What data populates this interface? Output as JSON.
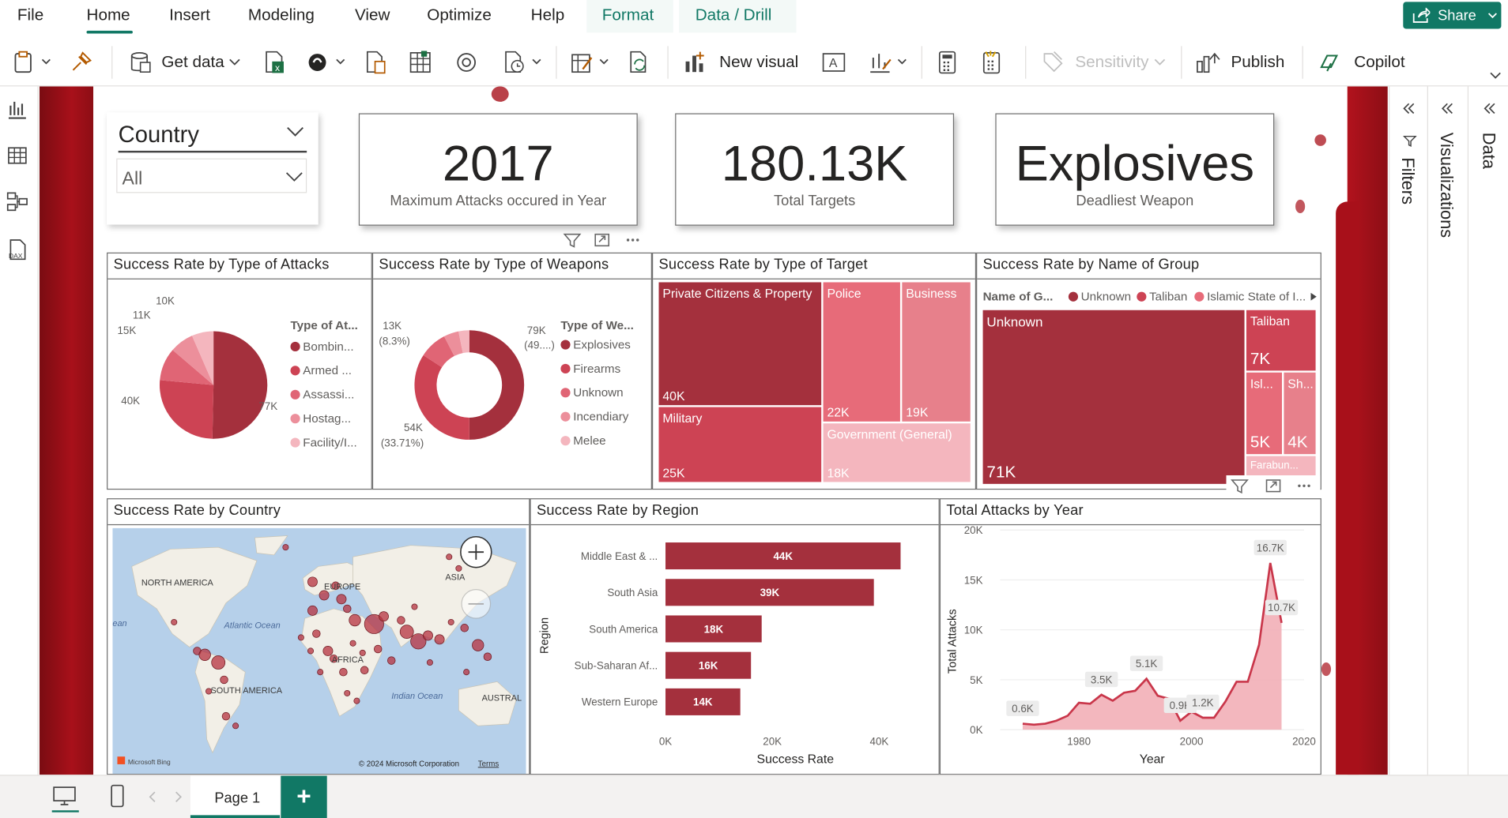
{
  "ribbon": {
    "menus": [
      "File",
      "Home",
      "Insert",
      "Modeling",
      "View",
      "Optimize",
      "Help"
    ],
    "context_menus": [
      "Format",
      "Data / Drill"
    ],
    "share_label": "Share",
    "tools": {
      "get_data": "Get data",
      "new_visual": "New visual",
      "sensitivity": "Sensitivity",
      "publish": "Publish",
      "copilot": "Copilot"
    }
  },
  "panes": {
    "filters": "Filters",
    "visualizations": "Visualizations",
    "data": "Data"
  },
  "slicer": {
    "title": "Country",
    "value": "All"
  },
  "kpis": [
    {
      "value": "2017",
      "label": "Maximum Attacks occured in Year"
    },
    {
      "value": "180.13K",
      "label": "Total Targets"
    },
    {
      "value": "Explosives",
      "label": "Deadliest Weapon"
    }
  ],
  "visuals": {
    "attack_types": {
      "title": "Success Rate by Type of Attacks",
      "legend_title": "Type of At...",
      "legend": [
        "Bombin...",
        "Armed ...",
        "Assassi...",
        "Hostag...",
        "Facility/I..."
      ],
      "labels": [
        "77K",
        "40K",
        "15K",
        "11K",
        "10K"
      ]
    },
    "weapons": {
      "title": "Success Rate by Type of Weapons",
      "legend_title": "Type of We...",
      "legend": [
        "Explosives",
        "Firearms",
        "Unknown",
        "Incendiary",
        "Melee"
      ],
      "labels": {
        "a": "79K",
        "a_pct": "(49....)",
        "b": "54K",
        "b_pct": "(33.71%)",
        "c": "13K",
        "c_pct": "(8.3%)"
      }
    },
    "target": {
      "title": "Success Rate by Type of Target",
      "cells": [
        {
          "name": "Private Citizens & Property",
          "value": "40K"
        },
        {
          "name": "Police",
          "value": "22K"
        },
        {
          "name": "Business",
          "value": "19K"
        },
        {
          "name": "Military",
          "value": "25K"
        },
        {
          "name": "Government (General)",
          "value": "18K"
        }
      ]
    },
    "group": {
      "title": "Success Rate by Name of Group",
      "legend_title": "Name of G...",
      "legend": [
        "Unknown",
        "Taliban",
        "Islamic State of I..."
      ],
      "cells": [
        {
          "name": "Unknown",
          "value": "71K"
        },
        {
          "name": "Taliban",
          "value": "7K"
        },
        {
          "name": "Isl...",
          "value": "5K"
        },
        {
          "name": "Sh...",
          "value": "4K"
        },
        {
          "name": "Farabun...",
          "value": ""
        }
      ]
    },
    "map": {
      "title": "Success Rate by Country",
      "labels": [
        "NORTH AMERICA",
        "EUROPE",
        "ASIA",
        "Atlantic Ocean",
        "AFRICA",
        "SOUTH AMERICA",
        "Indian Ocean",
        "AUSTRAL",
        "ean"
      ],
      "bing": "Microsoft Bing",
      "copyright": "© 2024 Microsoft Corporation",
      "terms": "Terms"
    },
    "region": {
      "title": "Success Rate by Region",
      "xlabel": "Success Rate",
      "ylabel": "Region"
    },
    "year": {
      "title": "Total Attacks by Year",
      "xlabel": "Year",
      "ylabel": "Total Attacks"
    }
  },
  "chart_data": [
    {
      "type": "bar",
      "title": "Success Rate by Region",
      "categories": [
        "Middle East & ...",
        "South Asia",
        "South America",
        "Sub-Saharan Af...",
        "Western Europe"
      ],
      "values": [
        44000,
        39000,
        18000,
        16000,
        14000
      ],
      "data_labels": [
        "44K",
        "39K",
        "18K",
        "16K",
        "14K"
      ],
      "xlabel": "Success Rate",
      "ylabel": "Region",
      "xlim": [
        0,
        45000
      ],
      "xticks": [
        "0K",
        "20K",
        "40K"
      ],
      "color": "#a4303d"
    },
    {
      "type": "area",
      "title": "Total Attacks by Year",
      "x": [
        1970,
        1972,
        1974,
        1976,
        1978,
        1980,
        1982,
        1984,
        1986,
        1988,
        1990,
        1992,
        1994,
        1996,
        1998,
        2000,
        2002,
        2004,
        2006,
        2008,
        2010,
        2012,
        2014,
        2016
      ],
      "y": [
        0.6,
        0.5,
        0.6,
        0.9,
        1.4,
        2.7,
        2.6,
        3.5,
        2.9,
        3.7,
        3.9,
        5.1,
        3.4,
        3.1,
        0.9,
        1.8,
        1.2,
        1.2,
        2.8,
        4.8,
        4.8,
        8.5,
        16.7,
        10.7
      ],
      "data_labels": [
        "0.6K",
        "3.5K",
        "5.1K",
        "0.9K",
        "1.2K",
        "16.7K",
        "10.7K"
      ],
      "unit": "thousand",
      "xlabel": "Year",
      "ylabel": "Total Attacks",
      "ylim": [
        0,
        20
      ],
      "yticks": [
        "0K",
        "5K",
        "10K",
        "15K",
        "20K"
      ],
      "xticks": [
        "1980",
        "2000",
        "2020"
      ],
      "color": "#c9364a"
    },
    {
      "type": "pie",
      "title": "Success Rate by Type of Attacks",
      "categories": [
        "Bombin...",
        "Armed ...",
        "Assassi...",
        "Hostag...",
        "Facility/I..."
      ],
      "values": [
        77,
        40,
        15,
        11,
        10
      ],
      "colors": [
        "#a4303d",
        "#cd4354",
        "#e06575",
        "#ec8f9b",
        "#f4b6be"
      ]
    },
    {
      "type": "pie",
      "title": "Success Rate by Type of Weapons",
      "categories": [
        "Explosives",
        "Firearms",
        "Unknown",
        "Incendiary",
        "Melee"
      ],
      "values": [
        79,
        54,
        13,
        7,
        5
      ],
      "colors": [
        "#a4303d",
        "#cd4354",
        "#e06575",
        "#ec8f9b",
        "#f4b6be"
      ]
    }
  ]
}
